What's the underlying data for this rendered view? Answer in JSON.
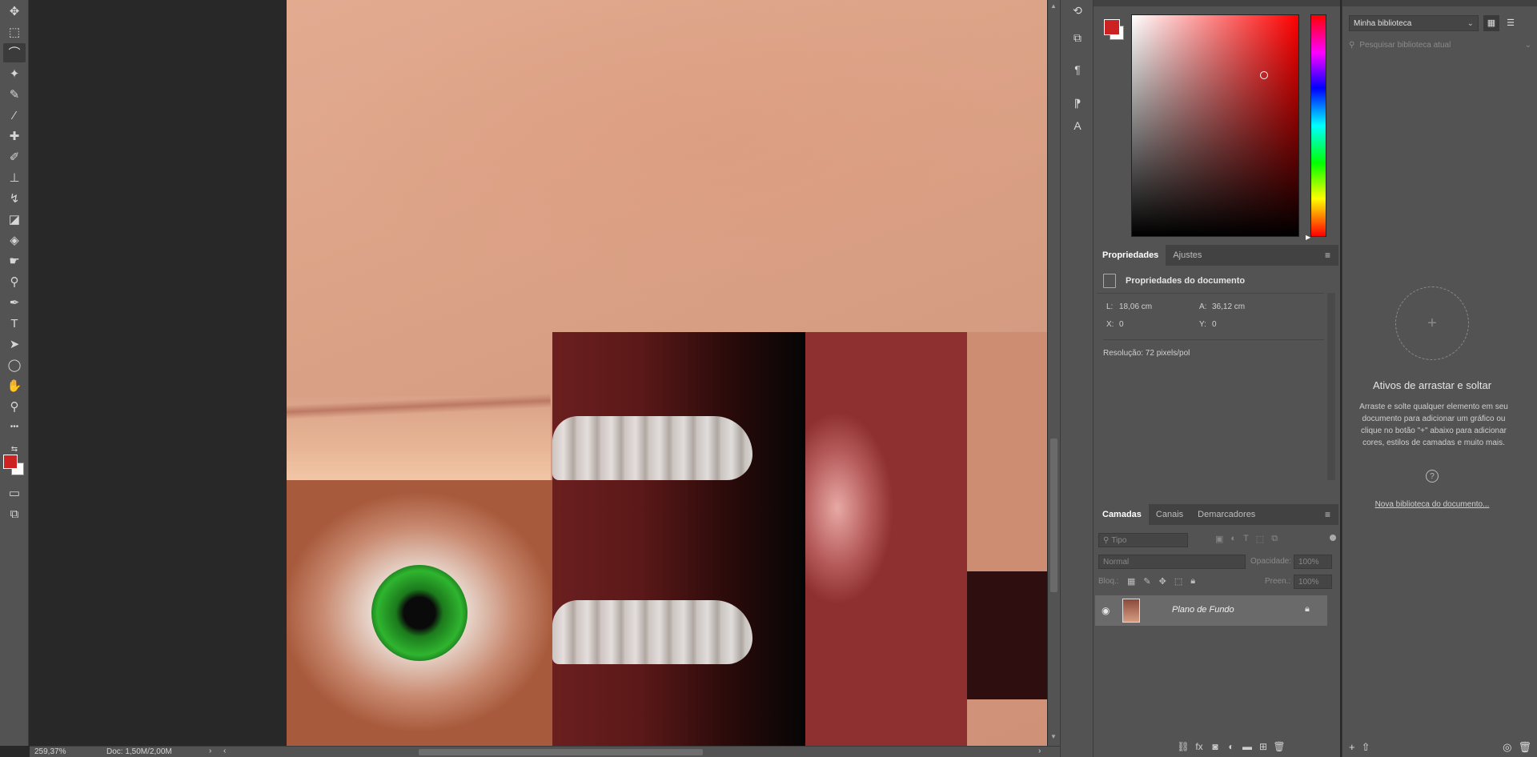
{
  "tools": [
    {
      "name": "move-tool-icon",
      "glyph": "✥"
    },
    {
      "name": "marquee-tool-icon",
      "glyph": "⬚"
    },
    {
      "name": "lasso-tool-icon",
      "glyph": "⌒"
    },
    {
      "name": "magic-wand-tool-icon",
      "glyph": "✦"
    },
    {
      "name": "crop-tool-icon",
      "glyph": "✎"
    },
    {
      "name": "eyedropper-tool-icon",
      "glyph": "⁄"
    },
    {
      "name": "healing-brush-tool-icon",
      "glyph": "✚"
    },
    {
      "name": "brush-tool-icon",
      "glyph": "✐"
    },
    {
      "name": "clone-stamp-tool-icon",
      "glyph": "⊥"
    },
    {
      "name": "history-brush-tool-icon",
      "glyph": "↯"
    },
    {
      "name": "eraser-tool-icon",
      "glyph": "◪"
    },
    {
      "name": "paint-bucket-tool-icon",
      "glyph": "◈"
    },
    {
      "name": "smudge-tool-icon",
      "glyph": "☛"
    },
    {
      "name": "dodge-tool-icon",
      "glyph": "⚲"
    },
    {
      "name": "pen-tool-icon",
      "glyph": "✒"
    },
    {
      "name": "type-tool-icon",
      "glyph": "T"
    },
    {
      "name": "path-selection-tool-icon",
      "glyph": "➤"
    },
    {
      "name": "ellipse-tool-icon",
      "glyph": "◯"
    },
    {
      "name": "hand-tool-icon",
      "glyph": "✋"
    },
    {
      "name": "zoom-tool-icon",
      "glyph": "⚲"
    },
    {
      "name": "more-tools-icon",
      "glyph": "•••"
    }
  ],
  "colors": {
    "foreground": "#cc2222",
    "background": "#ffffff",
    "accent": "#ff0000"
  },
  "status": {
    "zoom": "259,37%",
    "doc": "Doc: 1,50M/2,00M"
  },
  "properties": {
    "tabs": [
      {
        "label": "Propriedades"
      },
      {
        "label": "Ajustes"
      }
    ],
    "title": "Propriedades do documento",
    "w_label": "L:",
    "w_value": "18,06 cm",
    "h_label": "A:",
    "h_value": "36,12 cm",
    "x_label": "X:",
    "x_value": "0",
    "y_label": "Y:",
    "y_value": "0",
    "resolution": "Resolução: 72 pixels/pol"
  },
  "layers": {
    "tabs": [
      {
        "label": "Camadas"
      },
      {
        "label": "Canais"
      },
      {
        "label": "Demarcadores"
      }
    ],
    "filter_placeholder": "Tipo",
    "blend_mode": "Normal",
    "opacity_label": "Opacidade:",
    "opacity_value": "100%",
    "lock_label": "Bloq.:",
    "fill_label": "Preen.:",
    "fill_value": "100%",
    "items": [
      {
        "name": "Plano de Fundo"
      }
    ]
  },
  "library": {
    "selected": "Minha biblioteca",
    "search_placeholder": "Pesquisar biblioteca atual",
    "empty_title": "Ativos de arrastar e soltar",
    "empty_text": "Arraste e solte qualquer elemento em seu documento para adicionar um gráfico ou clique no botão \"+\" abaixo para adicionar cores, estilos de camadas e muito mais.",
    "new_link": "Nova biblioteca do documento..."
  }
}
